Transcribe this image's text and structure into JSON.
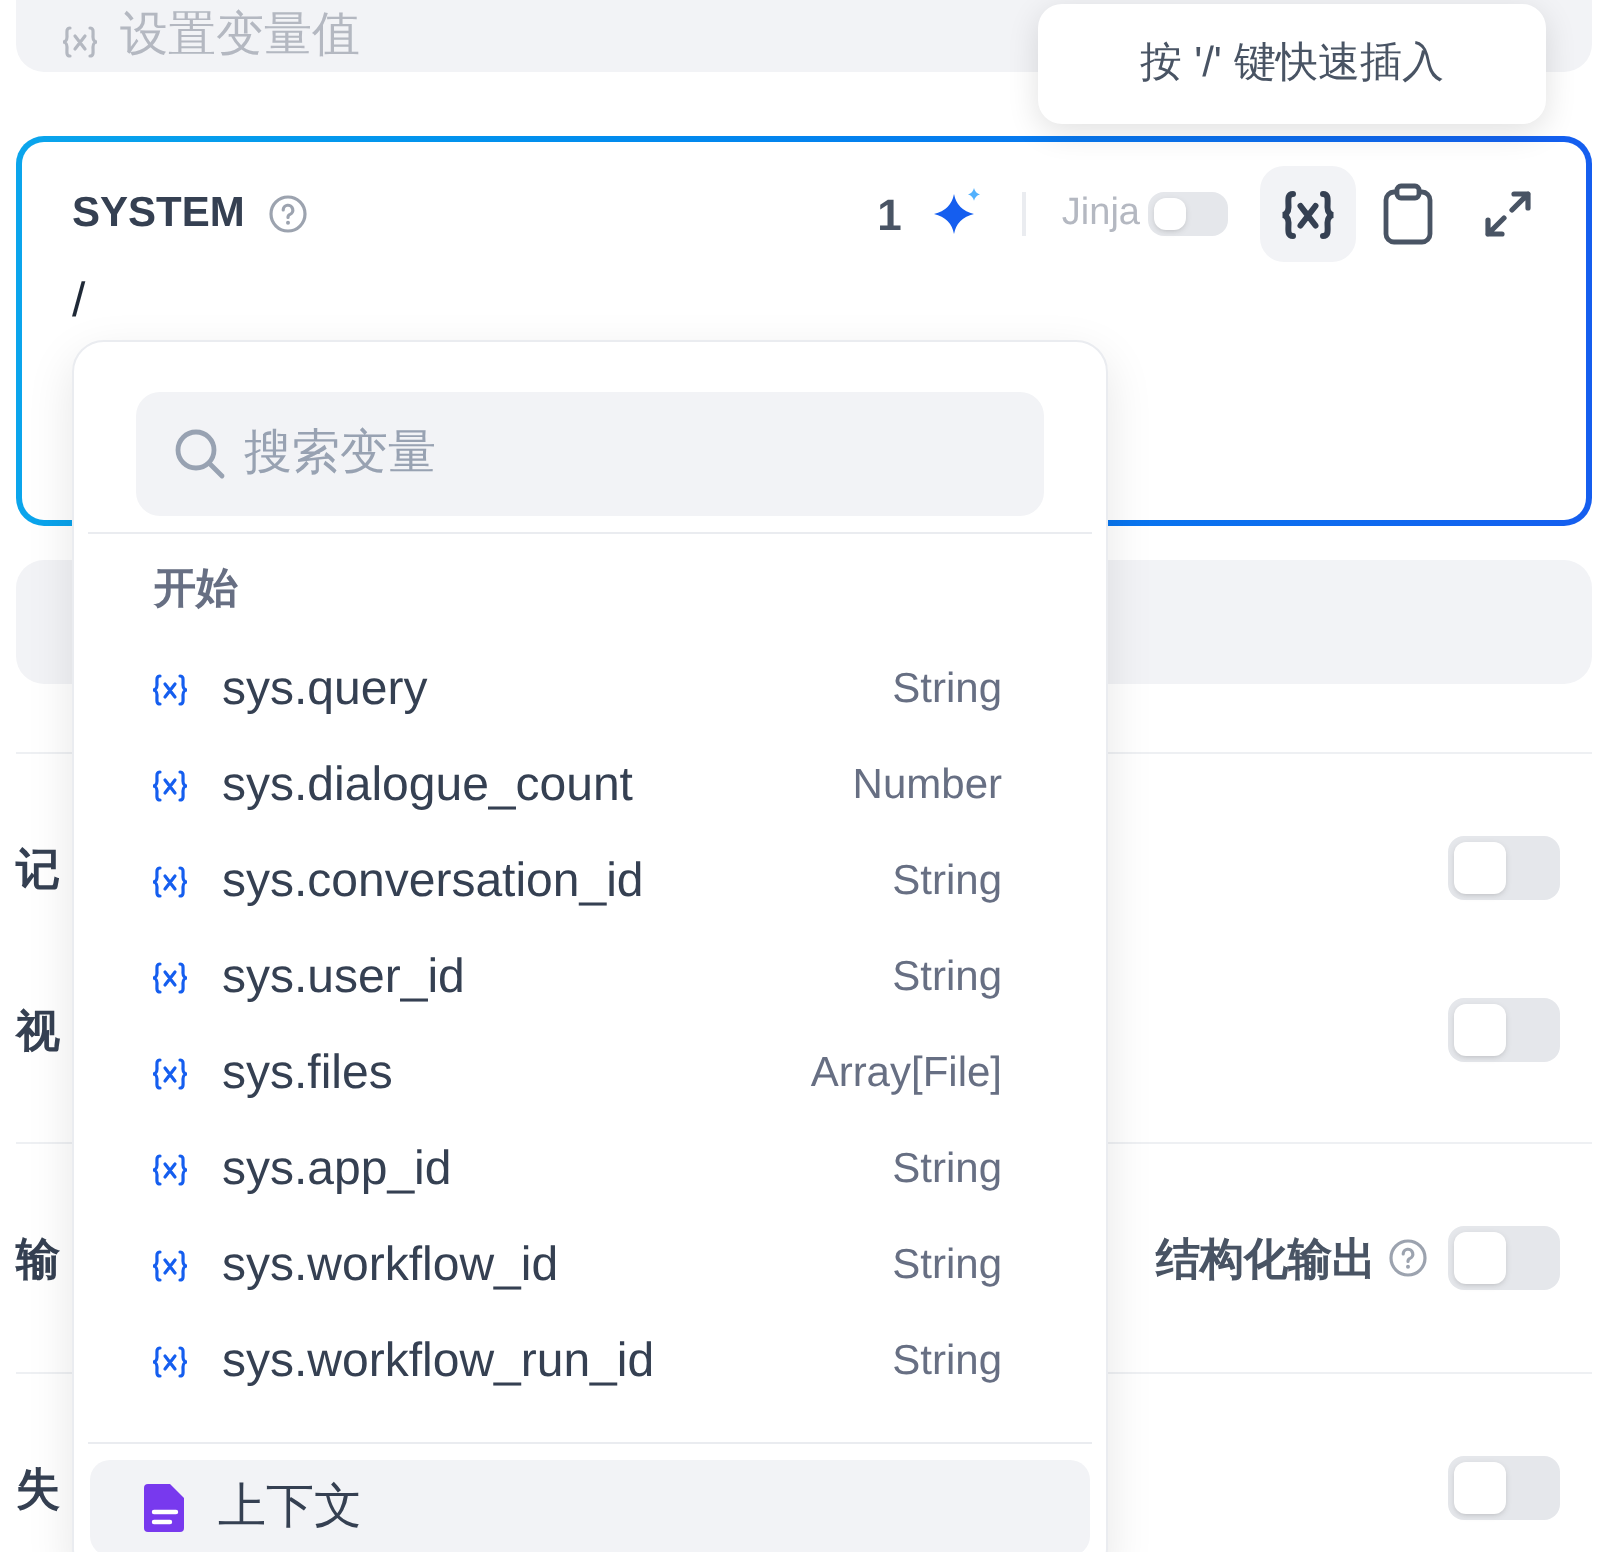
{
  "top_field": {
    "placeholder": "设置变量值"
  },
  "tooltip": "按 '/' 键快速插入",
  "editor": {
    "title": "SYSTEM",
    "count": "1",
    "jinja": {
      "label": "Jinja",
      "on": false
    },
    "variable_button_active": true,
    "value": "/"
  },
  "settings": [
    {
      "label": "记",
      "on": false
    },
    {
      "label": "视",
      "on": false
    }
  ],
  "output": {
    "label": "输",
    "structured_label": "结构化输出",
    "on": false
  },
  "retry": {
    "label": "失",
    "on": false
  },
  "popup": {
    "search_placeholder": "搜索变量",
    "group": "开始",
    "items": [
      {
        "name": "sys.query",
        "type": "String"
      },
      {
        "name": "sys.dialogue_count",
        "type": "Number"
      },
      {
        "name": "sys.conversation_id",
        "type": "String"
      },
      {
        "name": "sys.user_id",
        "type": "String"
      },
      {
        "name": "sys.files",
        "type": "Array[File]"
      },
      {
        "name": "sys.app_id",
        "type": "String"
      },
      {
        "name": "sys.workflow_id",
        "type": "String"
      },
      {
        "name": "sys.workflow_run_id",
        "type": "String"
      }
    ],
    "context": "上下文"
  }
}
